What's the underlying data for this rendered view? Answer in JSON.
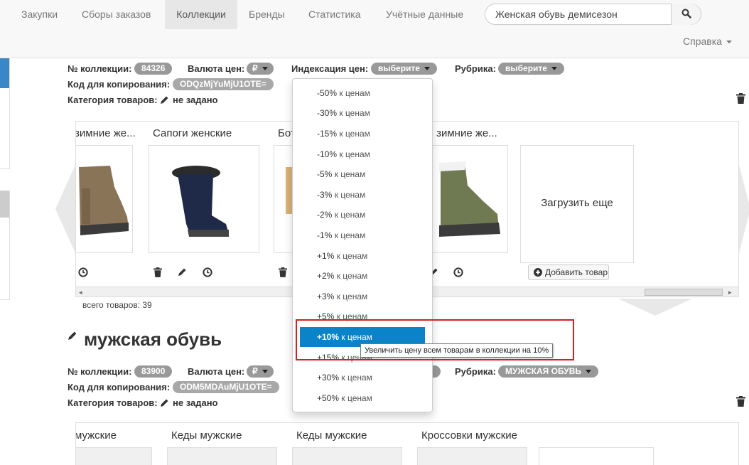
{
  "nav": {
    "items": [
      "Закупки",
      "Сборы заказов",
      "Коллекции",
      "Бренды",
      "Статистика",
      "Учётные данные"
    ],
    "active": "Коллекции",
    "search_value": "Женская обувь демисезон",
    "help_label": "Справка"
  },
  "collection1": {
    "number_label": "№ коллекции:",
    "number": "84326",
    "currency_label": "Валюта цен:",
    "currency": "₽",
    "index_label": "Индексация цен:",
    "index_value": "выберите",
    "rubric_label": "Рубрика:",
    "rubric_value": "выберите",
    "copy_code_label": "Код для копирования:",
    "copy_code": "ODQzMjYuMjU1OTE=",
    "category_label": "Категория товаров:",
    "category_value": "не задано",
    "products": [
      {
        "title": "зимние же..."
      },
      {
        "title": "Сапоги женские"
      },
      {
        "title": "Бот"
      },
      {
        "title": "ки зимние же..."
      }
    ],
    "load_more": "Загрузить еще",
    "add_product": "Добавить товар",
    "total": "всего товаров: 39"
  },
  "collection2": {
    "title": "мужская обувь",
    "number_label": "№ коллекции:",
    "number": "83900",
    "currency_label": "Валюта цен:",
    "currency": "₽",
    "rubric_label": "Рубрика:",
    "rubric_value": "МУЖСКАЯ ОБУВЬ",
    "copy_code_label": "Код для копирования:",
    "copy_code": "ODM5MDAuMjU1OTE=",
    "category_label": "Категория товаров:",
    "category_value": "не задано",
    "products": [
      {
        "title": "мужские"
      },
      {
        "title": "Кеды мужские"
      },
      {
        "title": "Кеды мужские"
      },
      {
        "title": "Кроссовки мужские"
      }
    ]
  },
  "dropdown": {
    "suffix": "к ценам",
    "items": [
      "-50%",
      "-30%",
      "-15%",
      "-10%",
      "-5%",
      "-3%",
      "-2%",
      "-1%",
      "+1%",
      "+2%",
      "+3%",
      "+5%",
      "+10%",
      "+15%",
      "+30%",
      "+50%"
    ],
    "active": "+10%",
    "tooltip": "Увеличить цену всем товарам в коллекции на 10%"
  },
  "colors": {
    "active_item": "#0b83c9",
    "highlight": "#d81e1e",
    "badge": "#999999"
  }
}
